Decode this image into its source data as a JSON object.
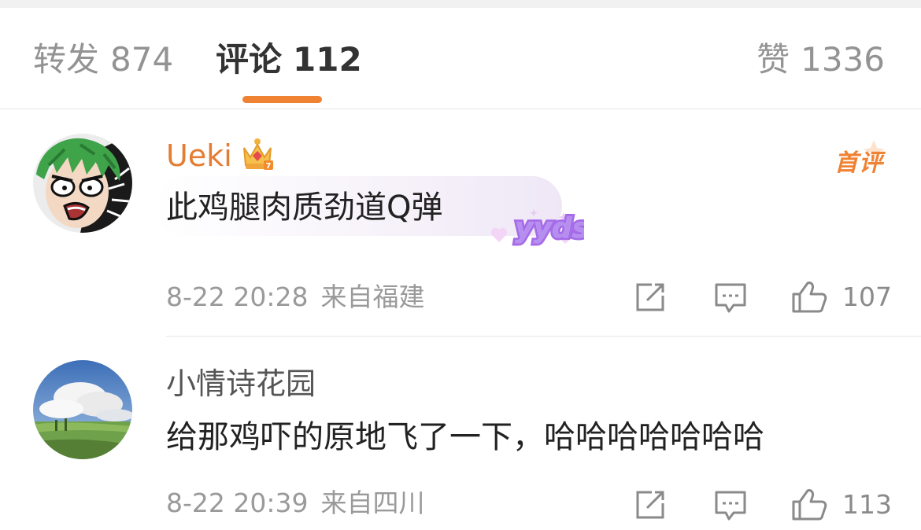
{
  "colors": {
    "accent": "#f08234",
    "username_vip": "#e47c33",
    "text_primary": "#222222",
    "text_secondary": "#9a9a9a",
    "yyds_purple": "#a66be8"
  },
  "tabs": [
    {
      "label": "转发",
      "count": "874"
    },
    {
      "label": "评论",
      "count": "112"
    },
    {
      "label": "赞",
      "count": "1336"
    }
  ],
  "comments": [
    {
      "username": "Ueki",
      "badge_icon": "crown-icon",
      "tag": "首评",
      "text": "此鸡腿肉质劲道Q弹",
      "decoration": "yyds",
      "time": "8-22 20:28",
      "location": "来自福建",
      "likes": "107"
    },
    {
      "username": "小情诗花园",
      "text": "给那鸡吓的原地飞了一下，哈哈哈哈哈哈哈",
      "time": "8-22 20:39",
      "location": "来自四川",
      "likes": "113"
    }
  ]
}
